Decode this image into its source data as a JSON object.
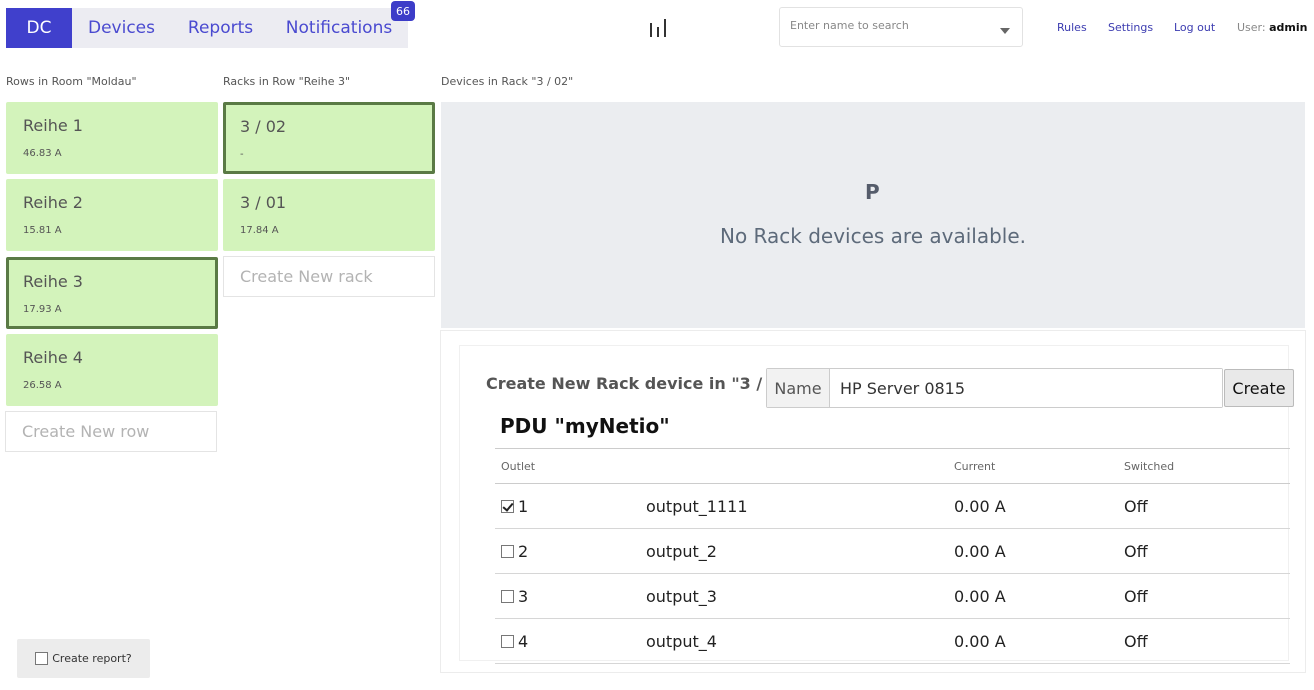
{
  "nav": {
    "tabs": [
      {
        "label": "DC"
      },
      {
        "label": "Devices"
      },
      {
        "label": "Reports"
      },
      {
        "label": "Notifications"
      }
    ],
    "notifications_badge": "66"
  },
  "search": {
    "placeholder": "Enter name to search"
  },
  "toplinks": {
    "rules": "Rules",
    "settings": "Settings",
    "logout": "Log out"
  },
  "user": {
    "label": "User:",
    "name": "admin"
  },
  "rows_column": {
    "title": "Rows in Room \"Moldau\"",
    "items": [
      {
        "name": "Reihe 1",
        "current": "46.83 A"
      },
      {
        "name": "Reihe 2",
        "current": "15.81 A"
      },
      {
        "name": "Reihe 3",
        "current": "17.93 A"
      },
      {
        "name": "Reihe 4",
        "current": "26.58 A"
      }
    ],
    "selected_index": 2,
    "create_placeholder": "Create New row"
  },
  "racks_column": {
    "title": "Racks in Row \"Reihe 3\"",
    "items": [
      {
        "name": "3 / 02",
        "current": "-"
      },
      {
        "name": "3 / 01",
        "current": "17.84 A"
      }
    ],
    "selected_index": 0,
    "create_placeholder": "Create New rack"
  },
  "devices_column": {
    "title": "Devices in Rack \"3 / 02\"",
    "empty_icon": "P",
    "empty_text": "No Rack devices are available."
  },
  "create_device": {
    "title": "Create New Rack device in \"3 /",
    "name_label": "Name",
    "name_value": "HP Server 0815",
    "button": "Create"
  },
  "pdu": {
    "title": "PDU \"myNetio\"",
    "columns": {
      "outlet": "Outlet",
      "name": "",
      "current": "Current",
      "switched": "Switched"
    },
    "outlets": [
      {
        "number": "1",
        "name": "output_1111",
        "current": "0.00 A",
        "switched": "Off",
        "checked": true
      },
      {
        "number": "2",
        "name": "output_2",
        "current": "0.00 A",
        "switched": "Off",
        "checked": false
      },
      {
        "number": "3",
        "name": "output_3",
        "current": "0.00 A",
        "switched": "Off",
        "checked": false
      },
      {
        "number": "4",
        "name": "output_4",
        "current": "0.00 A",
        "switched": "Off",
        "checked": false
      }
    ]
  },
  "report": {
    "label": "Create report?"
  },
  "colors": {
    "accent": "#4040cc",
    "card_green": "#d3f3bb",
    "selected_border": "#5a7a45"
  }
}
